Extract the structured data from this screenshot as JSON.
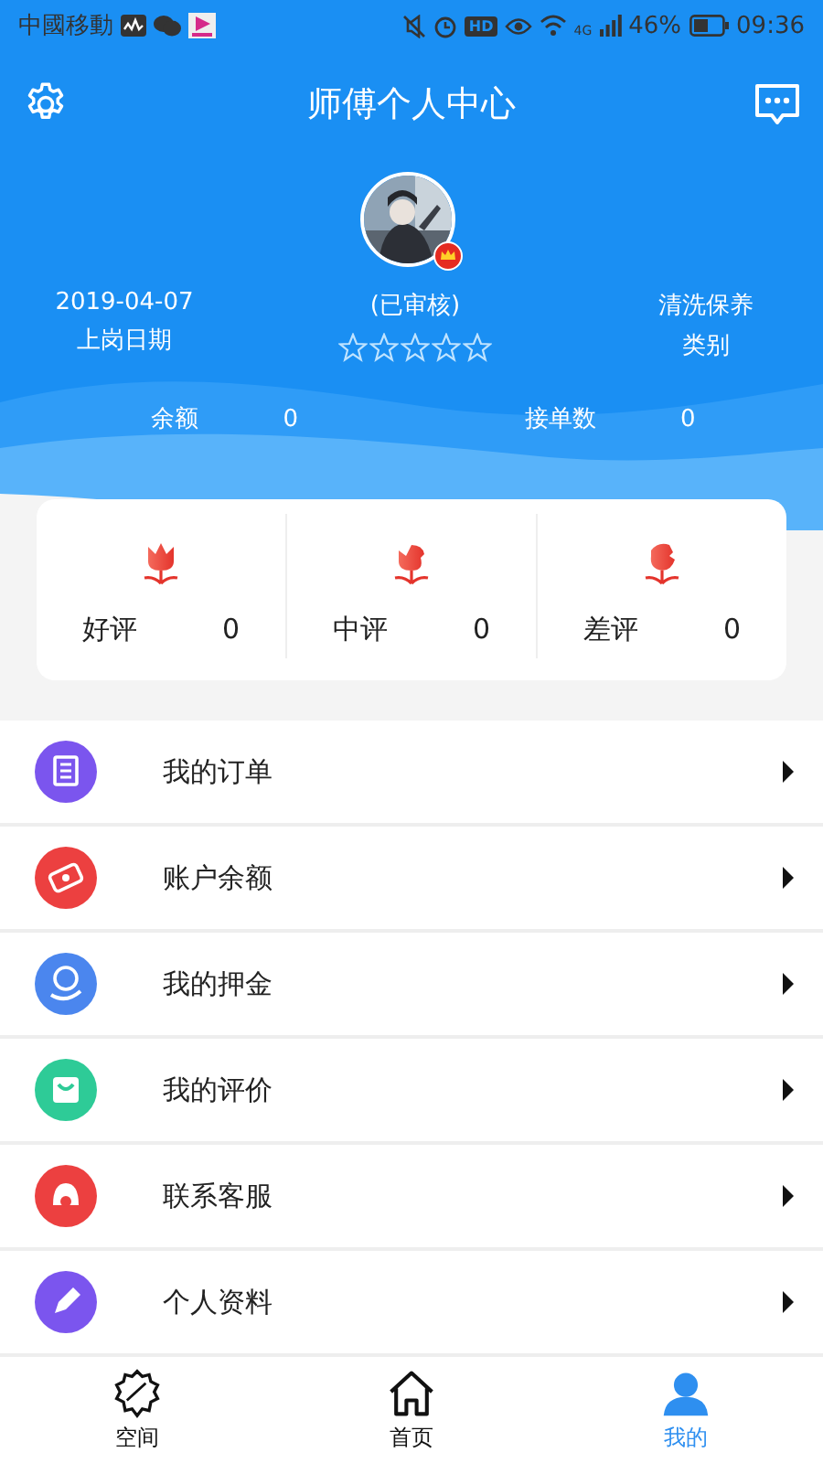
{
  "status_bar": {
    "carrier": "中國移動",
    "hd": "HD",
    "network": "4G",
    "battery": "46%",
    "time": "09:36"
  },
  "header": {
    "title": "师傅个人中心"
  },
  "profile": {
    "verified": "(已审核)",
    "stars": 0,
    "date": "2019-04-07",
    "date_label": "上岗日期",
    "category": "清洗保养",
    "category_label": "类别"
  },
  "stats": [
    {
      "label": "余额",
      "value": "0"
    },
    {
      "label": "接单数",
      "value": "0"
    }
  ],
  "ratings": [
    {
      "label": "好评",
      "value": "0"
    },
    {
      "label": "中评",
      "value": "0"
    },
    {
      "label": "差评",
      "value": "0"
    }
  ],
  "menu": [
    {
      "label": "我的订单",
      "color": "#7b55ee"
    },
    {
      "label": "账户余额",
      "color": "#ec4040"
    },
    {
      "label": "我的押金",
      "color": "#4b86ee"
    },
    {
      "label": "我的评价",
      "color": "#2ecb97"
    },
    {
      "label": "联系客服",
      "color": "#ec4040"
    },
    {
      "label": "个人资料",
      "color": "#7b55ee"
    }
  ],
  "tabs": [
    {
      "label": "空间",
      "kind": "space",
      "selected": false
    },
    {
      "label": "首页",
      "kind": "home",
      "selected": false
    },
    {
      "label": "我的",
      "kind": "profile",
      "selected": true
    }
  ]
}
